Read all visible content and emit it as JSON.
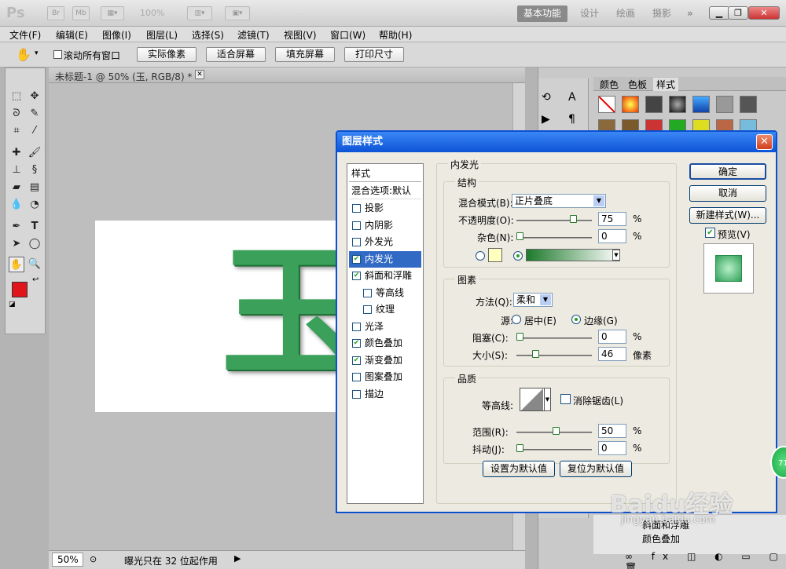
{
  "app": {
    "logo": "Ps",
    "zoom": "100%"
  },
  "workspaces": [
    "基本功能",
    "设计",
    "绘画",
    "摄影",
    "»"
  ],
  "menu": [
    "文件(F)",
    "编辑(E)",
    "图像(I)",
    "图层(L)",
    "选择(S)",
    "滤镜(T)",
    "视图(V)",
    "窗口(W)",
    "帮助(H)"
  ],
  "options": {
    "scroll_all": "滚动所有窗口",
    "actual_pixels": "实际像素",
    "fit_screen": "适合屏幕",
    "fill_screen": "填充屏幕",
    "print_size": "打印尺寸"
  },
  "document": {
    "tab_title": "未标题-1 @ 50% (玉, RGB/8) *",
    "art_text": "玉",
    "zoom": "50%",
    "status": "曝光只在 32 位起作用"
  },
  "panels": {
    "tabs": [
      "颜色",
      "色板",
      "样式"
    ]
  },
  "layers_peek": [
    "斜面和浮雕",
    "颜色叠加"
  ],
  "dialog": {
    "title": "图层样式",
    "styles_header": "样式",
    "blend_options": "混合选项:默认",
    "styles": [
      {
        "label": "投影",
        "checked": false
      },
      {
        "label": "内阴影",
        "checked": false
      },
      {
        "label": "外发光",
        "checked": false
      },
      {
        "label": "内发光",
        "checked": true
      },
      {
        "label": "斜面和浮雕",
        "checked": true
      },
      {
        "label": "等高线",
        "checked": false
      },
      {
        "label": "纹理",
        "checked": false
      },
      {
        "label": "光泽",
        "checked": false
      },
      {
        "label": "颜色叠加",
        "checked": true
      },
      {
        "label": "渐变叠加",
        "checked": true
      },
      {
        "label": "图案叠加",
        "checked": false
      },
      {
        "label": "描边",
        "checked": false
      }
    ],
    "panel_title": "内发光",
    "structure": {
      "title": "结构",
      "blend_mode_label": "混合模式(B):",
      "blend_mode_value": "正片叠底",
      "opacity_label": "不透明度(O):",
      "opacity_value": "75",
      "noise_label": "杂色(N):",
      "noise_value": "0",
      "percent": "%",
      "glow_color": "#ffffbf",
      "gradient_start": "#1d7a2b",
      "gradient_end": "#ffffff"
    },
    "elements": {
      "title": "图素",
      "technique_label": "方法(Q):",
      "technique_value": "柔和",
      "source_label": "源:",
      "center_label": "居中(E)",
      "edge_label": "边缘(G)",
      "choke_label": "阻塞(C):",
      "choke_value": "0",
      "size_label": "大小(S):",
      "size_value": "46",
      "size_unit": "像素",
      "percent": "%"
    },
    "quality": {
      "title": "品质",
      "contour_label": "等高线:",
      "antialias_label": "消除锯齿(L)",
      "range_label": "范围(R):",
      "range_value": "50",
      "jitter_label": "抖动(J):",
      "jitter_value": "0",
      "percent": "%"
    },
    "make_default": "设置为默认值",
    "reset_default": "复位为默认值",
    "ok": "确定",
    "cancel": "取消",
    "new_style": "新建样式(W)...",
    "preview": "预览(V)"
  },
  "watermark": {
    "brand": "Baidu经验",
    "url": "jingyan.baidu.com",
    "badge": "71"
  }
}
